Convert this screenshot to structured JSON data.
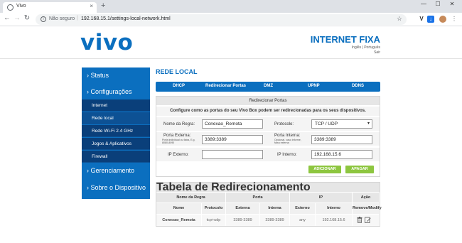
{
  "browser": {
    "tab_title": "Vivo",
    "tab_close": "×",
    "new_tab": "+",
    "window_controls": [
      "—",
      "☐",
      "✕"
    ],
    "security_text": "Não seguro",
    "url": "192.168.15.1/settings-local-network.html",
    "icons": [
      "favicon-globe",
      "back-arrow",
      "forward-arrow",
      "reload",
      "info",
      "star",
      "extension-v",
      "extension-download",
      "profile-avatar",
      "menu-dots"
    ]
  },
  "header": {
    "logo": "vivo",
    "product": "INTERNET FIXA",
    "languages": "Inglês | Português",
    "logout": "Sair",
    "brand_color": "#0b6fbf"
  },
  "sidebar": {
    "items": [
      {
        "label": "›  Status"
      },
      {
        "label": "›  Configurações"
      },
      {
        "label": "›  Gerenciamento"
      },
      {
        "label": "›  Sobre o Dispositivo"
      }
    ],
    "sub_items": [
      {
        "label": "Internet"
      },
      {
        "label": "Rede local",
        "active": true
      },
      {
        "label": "Rede Wi-Fi 2.4 GHz"
      },
      {
        "label": "Jogos & Aplicativos"
      },
      {
        "label": "Firewall"
      }
    ]
  },
  "main": {
    "section_title": "REDE LOCAL",
    "tabs": [
      {
        "label": "DHCP"
      },
      {
        "label": "Redirecionar Portas",
        "active": true
      },
      {
        "label": "DMZ"
      },
      {
        "label": "UPNP"
      },
      {
        "label": "DDNS"
      }
    ],
    "form": {
      "title": "Redirecionar Portas",
      "description": "Configure como as portas do seu Vivo Box podem ser redirecionadas para os seus dispositivos.",
      "rule_name_label": "Nome da Regra:",
      "rule_name_value": "Conexao_Remota",
      "protocol_label": "Protocolo:",
      "protocol_value": "TCP / UDP",
      "external_port_label": "Porta Externa:",
      "external_port_hint": "Porta individual ou faixa, E.g. 8080-8090",
      "external_port_value": "3389:3389",
      "internal_port_label": "Porta Interna:",
      "internal_port_hint": "Opcional, caso informe, faixa externa",
      "internal_port_value": "3389:3389",
      "external_ip_label": "IP Externo:",
      "external_ip_value": "",
      "internal_ip_label": "IP Interno:",
      "internal_ip_value": "192.168.15.6",
      "add_button": "ADICIONAR",
      "clear_button": "APAGAR",
      "button_color": "#8dc63f"
    },
    "table": {
      "title": "Tabela de Redirecionamento",
      "group_headers": [
        "Nome da Regra",
        "Porta",
        "IP",
        "Ação"
      ],
      "columns": [
        "Nome",
        "Protocolo",
        "Externa",
        "Interna",
        "Externo",
        "Interno",
        "Remove/Modify"
      ],
      "rows": [
        {
          "name": "Conexao_Remota",
          "protocol": "tcp+udp",
          "external": "3389-3389",
          "internal": "3389-3389",
          "ip_external": "any",
          "ip_internal": "192.168.15.6"
        }
      ]
    }
  }
}
